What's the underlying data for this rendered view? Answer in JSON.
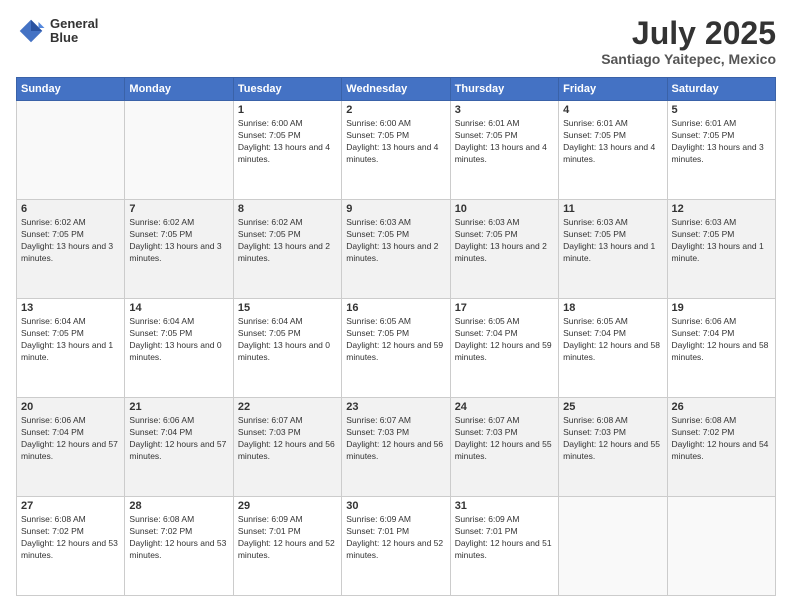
{
  "header": {
    "logo_line1": "General",
    "logo_line2": "Blue",
    "month": "July 2025",
    "location": "Santiago Yaitepec, Mexico"
  },
  "days_of_week": [
    "Sunday",
    "Monday",
    "Tuesday",
    "Wednesday",
    "Thursday",
    "Friday",
    "Saturday"
  ],
  "weeks": [
    [
      {
        "day": "",
        "text": ""
      },
      {
        "day": "",
        "text": ""
      },
      {
        "day": "1",
        "text": "Sunrise: 6:00 AM\nSunset: 7:05 PM\nDaylight: 13 hours and 4 minutes."
      },
      {
        "day": "2",
        "text": "Sunrise: 6:00 AM\nSunset: 7:05 PM\nDaylight: 13 hours and 4 minutes."
      },
      {
        "day": "3",
        "text": "Sunrise: 6:01 AM\nSunset: 7:05 PM\nDaylight: 13 hours and 4 minutes."
      },
      {
        "day": "4",
        "text": "Sunrise: 6:01 AM\nSunset: 7:05 PM\nDaylight: 13 hours and 4 minutes."
      },
      {
        "day": "5",
        "text": "Sunrise: 6:01 AM\nSunset: 7:05 PM\nDaylight: 13 hours and 3 minutes."
      }
    ],
    [
      {
        "day": "6",
        "text": "Sunrise: 6:02 AM\nSunset: 7:05 PM\nDaylight: 13 hours and 3 minutes."
      },
      {
        "day": "7",
        "text": "Sunrise: 6:02 AM\nSunset: 7:05 PM\nDaylight: 13 hours and 3 minutes."
      },
      {
        "day": "8",
        "text": "Sunrise: 6:02 AM\nSunset: 7:05 PM\nDaylight: 13 hours and 2 minutes."
      },
      {
        "day": "9",
        "text": "Sunrise: 6:03 AM\nSunset: 7:05 PM\nDaylight: 13 hours and 2 minutes."
      },
      {
        "day": "10",
        "text": "Sunrise: 6:03 AM\nSunset: 7:05 PM\nDaylight: 13 hours and 2 minutes."
      },
      {
        "day": "11",
        "text": "Sunrise: 6:03 AM\nSunset: 7:05 PM\nDaylight: 13 hours and 1 minute."
      },
      {
        "day": "12",
        "text": "Sunrise: 6:03 AM\nSunset: 7:05 PM\nDaylight: 13 hours and 1 minute."
      }
    ],
    [
      {
        "day": "13",
        "text": "Sunrise: 6:04 AM\nSunset: 7:05 PM\nDaylight: 13 hours and 1 minute."
      },
      {
        "day": "14",
        "text": "Sunrise: 6:04 AM\nSunset: 7:05 PM\nDaylight: 13 hours and 0 minutes."
      },
      {
        "day": "15",
        "text": "Sunrise: 6:04 AM\nSunset: 7:05 PM\nDaylight: 13 hours and 0 minutes."
      },
      {
        "day": "16",
        "text": "Sunrise: 6:05 AM\nSunset: 7:05 PM\nDaylight: 12 hours and 59 minutes."
      },
      {
        "day": "17",
        "text": "Sunrise: 6:05 AM\nSunset: 7:04 PM\nDaylight: 12 hours and 59 minutes."
      },
      {
        "day": "18",
        "text": "Sunrise: 6:05 AM\nSunset: 7:04 PM\nDaylight: 12 hours and 58 minutes."
      },
      {
        "day": "19",
        "text": "Sunrise: 6:06 AM\nSunset: 7:04 PM\nDaylight: 12 hours and 58 minutes."
      }
    ],
    [
      {
        "day": "20",
        "text": "Sunrise: 6:06 AM\nSunset: 7:04 PM\nDaylight: 12 hours and 57 minutes."
      },
      {
        "day": "21",
        "text": "Sunrise: 6:06 AM\nSunset: 7:04 PM\nDaylight: 12 hours and 57 minutes."
      },
      {
        "day": "22",
        "text": "Sunrise: 6:07 AM\nSunset: 7:03 PM\nDaylight: 12 hours and 56 minutes."
      },
      {
        "day": "23",
        "text": "Sunrise: 6:07 AM\nSunset: 7:03 PM\nDaylight: 12 hours and 56 minutes."
      },
      {
        "day": "24",
        "text": "Sunrise: 6:07 AM\nSunset: 7:03 PM\nDaylight: 12 hours and 55 minutes."
      },
      {
        "day": "25",
        "text": "Sunrise: 6:08 AM\nSunset: 7:03 PM\nDaylight: 12 hours and 55 minutes."
      },
      {
        "day": "26",
        "text": "Sunrise: 6:08 AM\nSunset: 7:02 PM\nDaylight: 12 hours and 54 minutes."
      }
    ],
    [
      {
        "day": "27",
        "text": "Sunrise: 6:08 AM\nSunset: 7:02 PM\nDaylight: 12 hours and 53 minutes."
      },
      {
        "day": "28",
        "text": "Sunrise: 6:08 AM\nSunset: 7:02 PM\nDaylight: 12 hours and 53 minutes."
      },
      {
        "day": "29",
        "text": "Sunrise: 6:09 AM\nSunset: 7:01 PM\nDaylight: 12 hours and 52 minutes."
      },
      {
        "day": "30",
        "text": "Sunrise: 6:09 AM\nSunset: 7:01 PM\nDaylight: 12 hours and 52 minutes."
      },
      {
        "day": "31",
        "text": "Sunrise: 6:09 AM\nSunset: 7:01 PM\nDaylight: 12 hours and 51 minutes."
      },
      {
        "day": "",
        "text": ""
      },
      {
        "day": "",
        "text": ""
      }
    ]
  ]
}
